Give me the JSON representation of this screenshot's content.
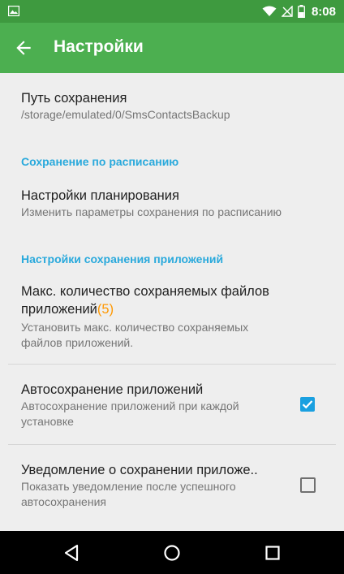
{
  "statusbar": {
    "time": "8:08",
    "icons": [
      "image-icon",
      "wifi-icon",
      "no-signal-icon",
      "battery-icon"
    ]
  },
  "appbar": {
    "title": "Настройки",
    "back_icon": "arrow-left-icon"
  },
  "settings": {
    "save_path": {
      "title": "Путь сохранения",
      "summary": "/storage/emulated/0/SmsContactsBackup"
    },
    "section_schedule": "Сохранение по расписанию",
    "schedule_settings": {
      "title": "Настройки планирования",
      "summary": "Изменить параметры сохранения по расписанию"
    },
    "section_apps": "Настройки сохранения приложений",
    "max_files": {
      "title_line1": "Макс. количество сохраняемых файлов",
      "title_line2": "приложений",
      "count": "(5)",
      "summary_line1": "Установить макс. количество сохраняемых",
      "summary_line2": "файлов приложений."
    },
    "autosave": {
      "title": "Автосохранение приложений",
      "summary_line1": "Автосохранение приложений при каждой",
      "summary_line2": "установке",
      "checked": true
    },
    "notify": {
      "title": "Уведомление о сохранении приложе..",
      "summary_line1": "Показать уведомление после успешного",
      "summary_line2": "автосохранения",
      "checked": false
    }
  },
  "navbar": {
    "buttons": [
      "back-triangle-icon",
      "home-circle-icon",
      "recents-square-icon"
    ]
  },
  "colors": {
    "statusbar": "#3e9a3f",
    "appbar": "#4caf50",
    "section": "#29a9dc",
    "accent": "#ff9800",
    "checkbox": "#1aa0e0"
  }
}
